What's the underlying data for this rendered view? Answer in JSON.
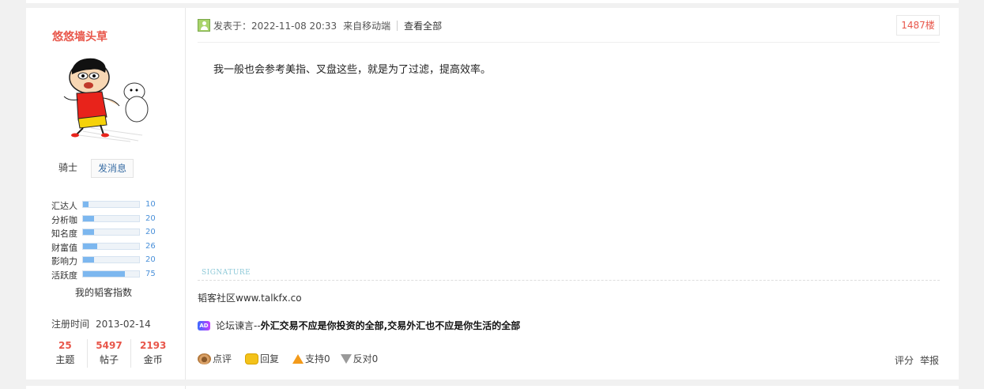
{
  "user": {
    "name": "悠悠墙头草",
    "rank": "骑士",
    "message_button": "发消息",
    "stats": [
      {
        "label": "汇达人",
        "value": "10",
        "fill": 0.1
      },
      {
        "label": "分析咖",
        "value": "20",
        "fill": 0.2
      },
      {
        "label": "知名度",
        "value": "20",
        "fill": 0.2
      },
      {
        "label": "财富值",
        "value": "26",
        "fill": 0.26
      },
      {
        "label": "影响力",
        "value": "20",
        "fill": 0.2
      },
      {
        "label": "活跃度",
        "value": "75",
        "fill": 0.75
      }
    ],
    "index_label": "我的韬客指数",
    "register_label": "注册时间",
    "register_date": "2013-02-14",
    "counts": [
      {
        "value": "25",
        "label": "主题"
      },
      {
        "value": "5497",
        "label": "帖子"
      },
      {
        "value": "2193",
        "label": "金币"
      }
    ]
  },
  "post": {
    "posted_at": "发表于：2022-11-08 20:33",
    "source": "来自移动端",
    "view_all": "查看全部",
    "floor": "1487楼",
    "content": "我一般也会参考美指、叉盘这些，就是为了过滤，提高效率。",
    "signature_label": "SIGNATURE",
    "signature": "韬客社区www.talkfx.co",
    "ad_icon": "AD",
    "ad_tag": "论坛谏言--",
    "ad_text": "外汇交易不应是你投资的全部,交易外汇也不应是你生活的全部"
  },
  "actions": {
    "comment": "点评",
    "reply": "回复",
    "support": "支持0",
    "oppose": "反对0",
    "rate": "评分",
    "report": "举报"
  },
  "colors": {
    "accent_red": "#e8564a",
    "link_blue": "#3a6ea5",
    "bar_fill": "#7cb7ef"
  }
}
